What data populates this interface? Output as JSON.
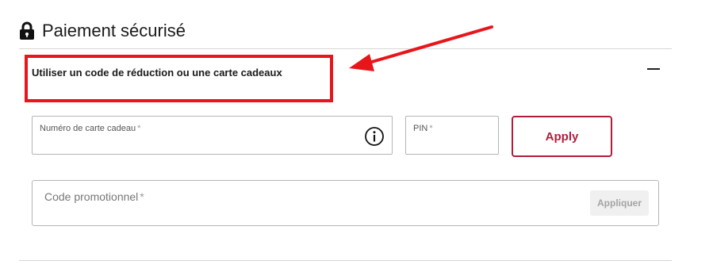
{
  "page": {
    "title": "Paiement sécurisé",
    "title_icon": "lock-icon"
  },
  "discount_section": {
    "header": "Utiliser un code de réduction ou une carte cadeaux",
    "collapse_icon": "minus-icon",
    "expanded": true
  },
  "gift_card": {
    "number_label": "Numéro de carte cadeau",
    "number_value": "",
    "info_icon": "info-icon",
    "pin_label": "PIN",
    "pin_value": "",
    "required_mark": "*",
    "apply_label": "Apply"
  },
  "promo": {
    "label": "Code promotionnel",
    "value": "",
    "required_mark": "*",
    "apply_label": "Appliquer",
    "apply_enabled": false
  },
  "annotation": {
    "color": "#e8161b",
    "target": "discount-section-header"
  },
  "colors": {
    "accent": "#b01d3a",
    "divider": "#d6d6d6",
    "field_border": "#b5b5b5",
    "disabled_bg": "#f0f0f0",
    "disabled_text": "#a4a4a4"
  }
}
